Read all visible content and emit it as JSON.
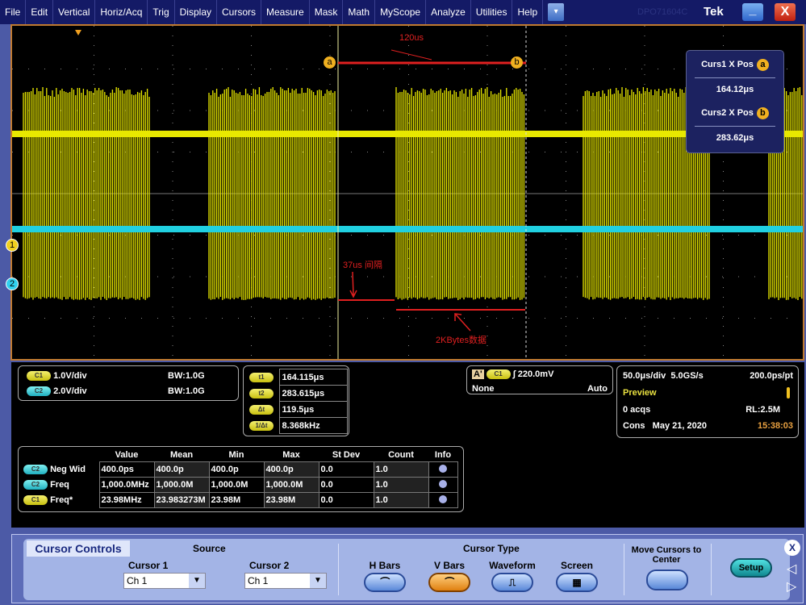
{
  "menubar": {
    "items": [
      "File",
      "Edit",
      "Vertical",
      "Horiz/Acq",
      "Trig",
      "Display",
      "Cursors",
      "Measure",
      "Mask",
      "Math",
      "MyScope",
      "Analyze",
      "Utilities",
      "Help"
    ],
    "brand": "Tek",
    "faded_text": "DPO71604C",
    "minimize": "_",
    "close": "X"
  },
  "colors": {
    "ch1": "#e8e800",
    "ch2": "#20d0e0",
    "cursor": "#e02020",
    "graticule_border": "#c07a30"
  },
  "annotations": {
    "span": "120us",
    "gap": "37us 间隔",
    "data": "2KBytes数据",
    "cursor_a": "a",
    "cursor_b": "b"
  },
  "markers": {
    "ch1": "1",
    "ch2": "2"
  },
  "cursor_readout": {
    "curs1_label": "Curs1 X Pos",
    "curs1_value": "164.12μs",
    "curs2_label": "Curs2 X Pos",
    "curs2_value": "283.62μs"
  },
  "channels": [
    {
      "badge": "C1",
      "scale": "1.0V/div",
      "bw": "1.0G",
      "bw_label": "BW"
    },
    {
      "badge": "C2",
      "scale": "2.0V/div",
      "bw": "1.0G",
      "bw_label": "BW"
    }
  ],
  "cursors": [
    {
      "badge": "t1",
      "value": "164.115μs"
    },
    {
      "badge": "t2",
      "value": "283.615μs"
    },
    {
      "badge": "Δt",
      "value": "119.5μs"
    },
    {
      "badge": "1/Δt",
      "value": "8.368kHz"
    }
  ],
  "trigger": {
    "badge_a": "A'",
    "source": "C1",
    "slope": "rising",
    "level": "220.0mV",
    "coupling": "None",
    "mode": "Auto"
  },
  "acquisition": {
    "timebase": "50.0μs/div",
    "sample_rate": "5.0GS/s",
    "resolution": "200.0ps/pt",
    "state": "Preview",
    "acqs": "0 acqs",
    "record_length": "RL:2.5M",
    "mode": "Cons",
    "date": "May 21, 2020",
    "time": "15:38:03"
  },
  "measurements": {
    "headers": [
      "Value",
      "Mean",
      "Min",
      "Max",
      "St Dev",
      "Count",
      "Info"
    ],
    "rows": [
      {
        "badge": "C2",
        "name": "Neg Wid",
        "values": [
          "400.0ps",
          "400.0p",
          "400.0p",
          "400.0p",
          "0.0",
          "1.0"
        ]
      },
      {
        "badge": "C2",
        "name": "Freq",
        "values": [
          "1,000.0MHz",
          "1,000.0M",
          "1,000.0M",
          "1,000.0M",
          "0.0",
          "1.0"
        ]
      },
      {
        "badge": "C1",
        "name": "Freq*",
        "values": [
          "23.98MHz",
          "23.983273M",
          "23.98M",
          "23.98M",
          "0.0",
          "1.0"
        ]
      }
    ]
  },
  "cursor_controls": {
    "title": "Cursor Controls",
    "source_label": "Source",
    "cursor1_label": "Cursor 1",
    "cursor1_value": "Ch 1",
    "cursor2_label": "Cursor 2",
    "cursor2_value": "Ch 1",
    "type_label": "Cursor Type",
    "types": [
      "H Bars",
      "V Bars",
      "Waveform",
      "Screen"
    ],
    "selected_type": "V Bars",
    "move_label": "Move Cursors to Center",
    "setup": "Setup",
    "close": "X"
  }
}
